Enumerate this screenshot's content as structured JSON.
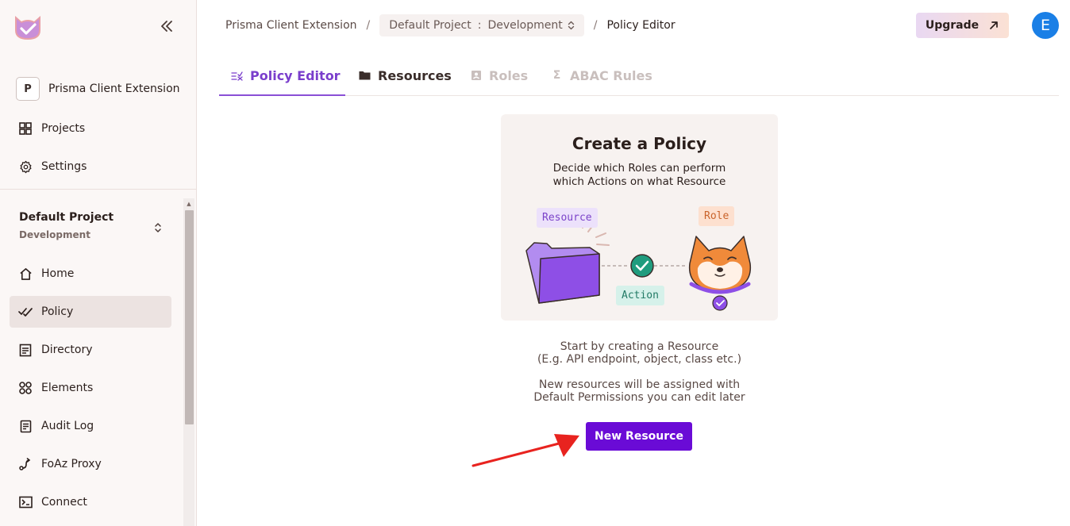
{
  "sidebar": {
    "org": {
      "badge": "P",
      "name": "Prisma Client Extension"
    },
    "top_items": [
      {
        "label": "Projects",
        "icon": "grid-icon"
      },
      {
        "label": "Settings",
        "icon": "gear-icon"
      }
    ],
    "project": {
      "name": "Default Project",
      "environment": "Development"
    },
    "items": [
      {
        "label": "Home",
        "icon": "home-icon",
        "active": false
      },
      {
        "label": "Policy",
        "icon": "policy-check-icon",
        "active": true
      },
      {
        "label": "Directory",
        "icon": "directory-icon",
        "active": false
      },
      {
        "label": "Elements",
        "icon": "elements-icon",
        "active": false
      },
      {
        "label": "Audit Log",
        "icon": "audit-log-icon",
        "active": false
      },
      {
        "label": "FoAz Proxy",
        "icon": "proxy-icon",
        "active": false
      },
      {
        "label": "Connect",
        "icon": "terminal-icon",
        "active": false
      }
    ]
  },
  "header": {
    "breadcrumb": {
      "org": "Prisma Client Extension",
      "project": "Default Project",
      "environment": "Development",
      "current": "Policy Editor"
    },
    "upgrade_label": "Upgrade",
    "avatar_initial": "E"
  },
  "tabs": [
    {
      "label": "Policy Editor",
      "state": "active"
    },
    {
      "label": "Resources",
      "state": "normal"
    },
    {
      "label": "Roles",
      "state": "disabled"
    },
    {
      "label": "ABAC Rules",
      "state": "disabled"
    }
  ],
  "card": {
    "title": "Create a Policy",
    "subtitle_line1": "Decide which Roles can perform",
    "subtitle_line2": "which Actions on what Resource",
    "chip_resource": "Resource",
    "chip_role": "Role",
    "chip_action": "Action"
  },
  "info": {
    "line1": "Start by creating a Resource",
    "line2": "(E.g. API endpoint, object, class etc.)",
    "line3": "New resources will be assigned with",
    "line4": "Default Permissions you can edit later"
  },
  "new_resource_label": "New Resource",
  "colors": {
    "accent": "#6a0bd6",
    "tab_active": "#7a3ecc",
    "avatar": "#1a7fe6",
    "annotation_arrow": "#e8231f"
  }
}
